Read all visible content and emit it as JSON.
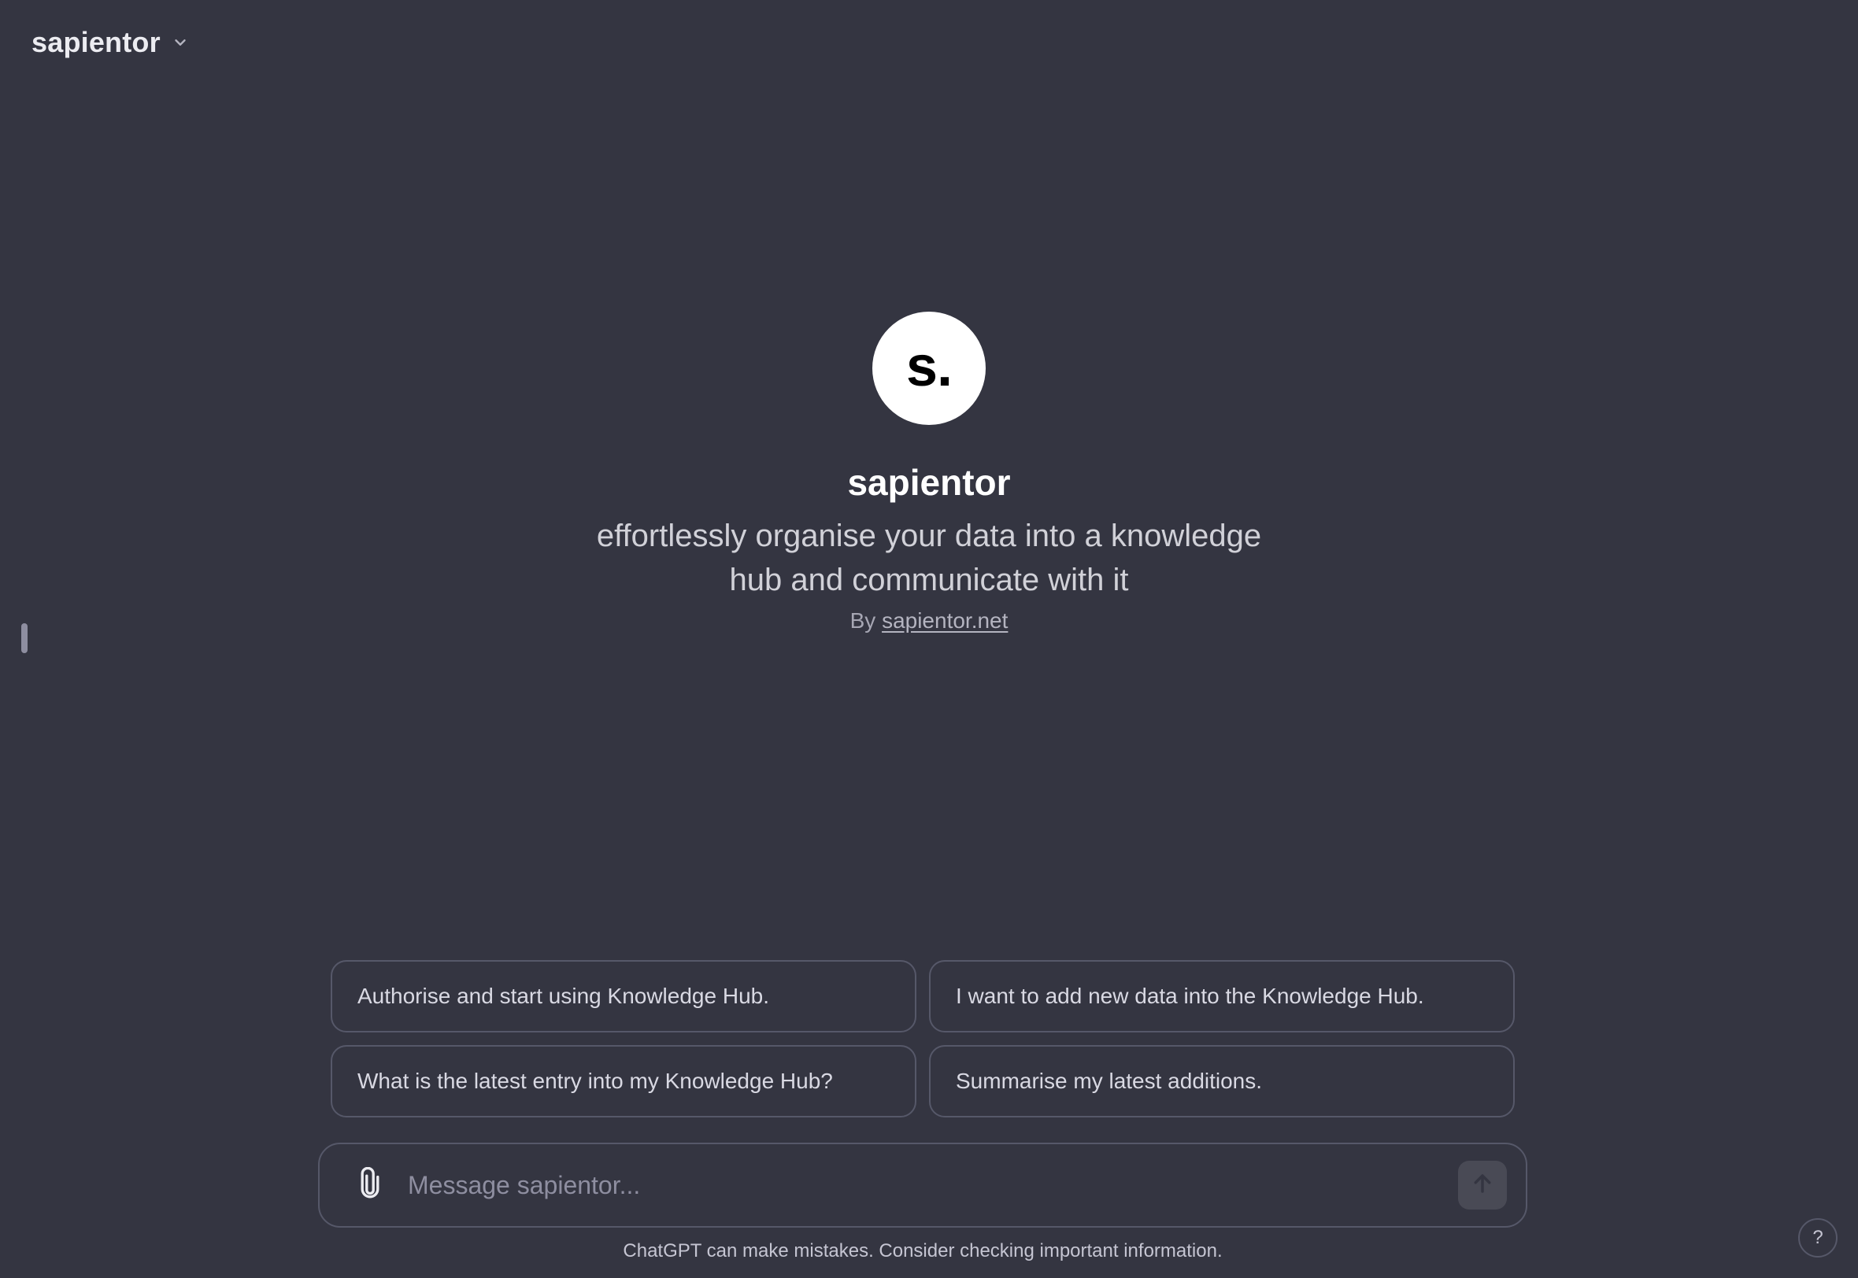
{
  "header": {
    "model_name": "sapientor",
    "selector_icon": "chevron-down-icon"
  },
  "gpt": {
    "avatar_text": "s.",
    "title": "sapientor",
    "description": "effortlessly organise your data into a knowledge hub and communicate with it",
    "by_prefix": "By",
    "author": "sapientor.net"
  },
  "starters": [
    {
      "label": "Authorise and start using Knowledge Hub."
    },
    {
      "label": "I want to add new data into the Knowledge Hub."
    },
    {
      "label": "What is the latest entry into my Knowledge Hub?"
    },
    {
      "label": "Summarise my latest additions."
    }
  ],
  "composer": {
    "placeholder": "Message sapientor...",
    "value": "",
    "attach_icon": "paperclip-icon",
    "send_icon": "arrow-up-icon"
  },
  "footer": {
    "disclaimer": "ChatGPT can make mistakes. Consider checking important information.",
    "help_label": "?"
  },
  "colors": {
    "background": "#343541",
    "border": "#565869",
    "text_primary": "#ececf1",
    "text_muted": "#8e8ea0"
  }
}
